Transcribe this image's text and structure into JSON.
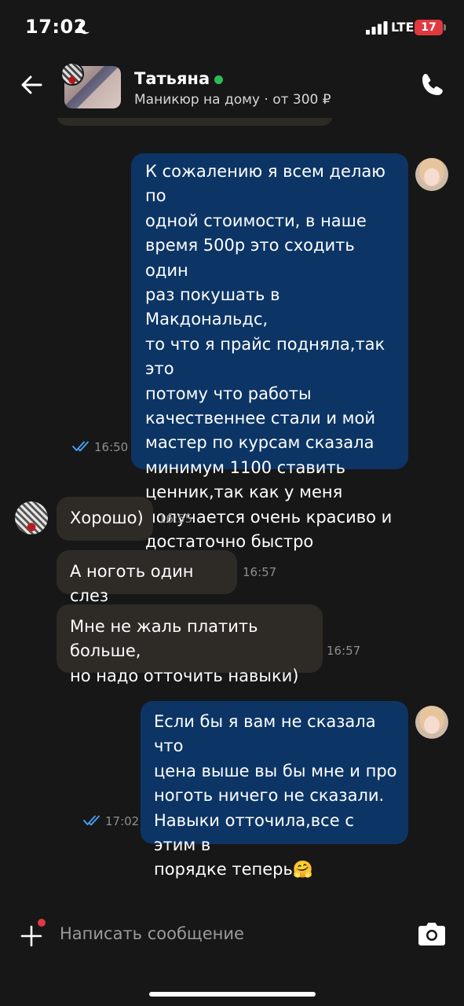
{
  "status_bar": {
    "time": "17:02",
    "network": "LTE",
    "battery": "17"
  },
  "header": {
    "contact_name": "Татьяна",
    "service": "Маникюр на дому · от 300 ₽"
  },
  "messages": [
    {
      "direction": "out",
      "text": "К сожалению я всем делаю по\nодной стоимости, в наше\nвремя 500р это сходить один\nраз покушать в Макдональдс,\nто что я прайс подняла,так это\nпотому что работы\nкачественнее стали и мой\nмастер по курсам сказала\nминимум 1100 ставить\nценник,так как у меня\nполучается очень красиво и\nдостаточно быстро",
      "time": "16:50",
      "read": true
    },
    {
      "direction": "in",
      "text": "Хорошо)",
      "time": "16:55"
    },
    {
      "direction": "in",
      "text": "А ноготь один слез",
      "time": "16:57"
    },
    {
      "direction": "in",
      "text": "Мне не жаль платить больше,\nно надо отточить навыки)",
      "time": "16:57"
    },
    {
      "direction": "out",
      "text": "Если бы я вам не сказала что\nцена выше вы бы мне и про\nноготь ничего не сказали.\nНавыки отточила,все с этим в\nпорядке теперь🤗",
      "time": "17:02",
      "read": true
    }
  ],
  "input": {
    "placeholder": "Написать сообщение"
  },
  "colors": {
    "background": "#171717",
    "outgoing_bubble": "#0c3566",
    "incoming_bubble": "#2e2a26",
    "online": "#2bbd55",
    "read_check": "#4aa3ff",
    "badge": "#e0393f"
  }
}
